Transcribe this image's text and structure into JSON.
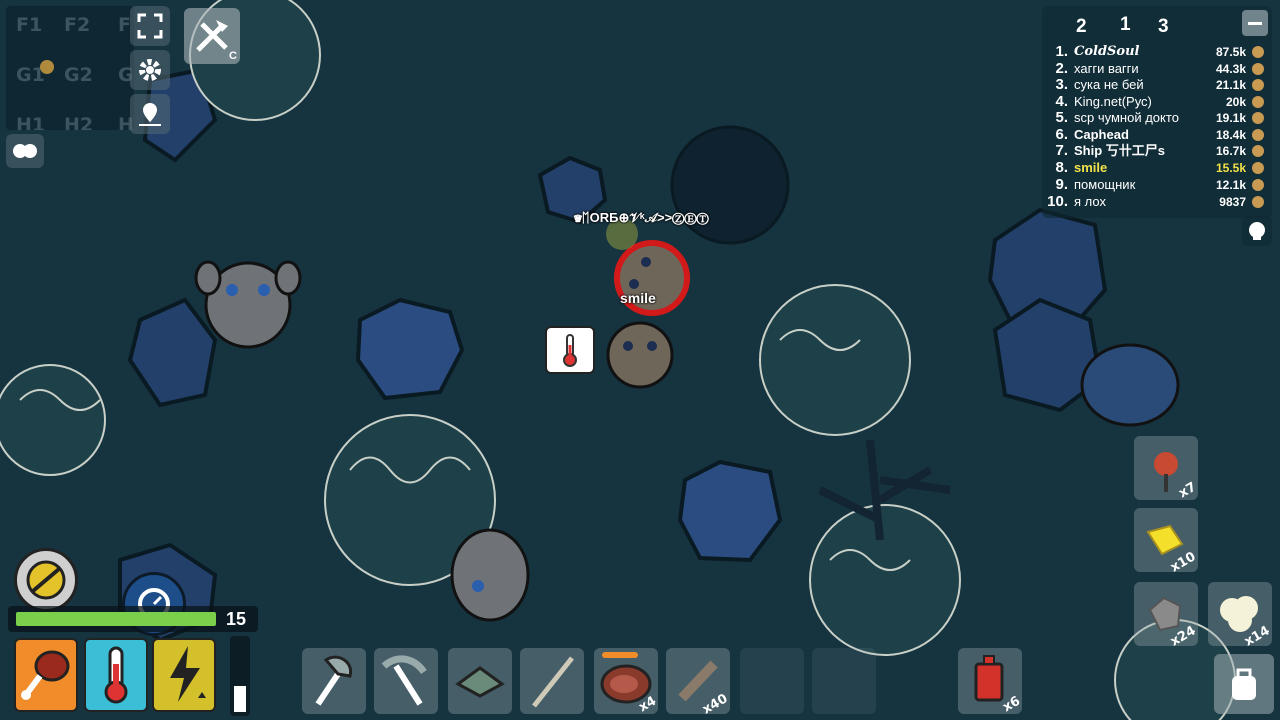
{
  "minimap": {
    "cells": [
      {
        "label": "F1"
      },
      {
        "label": "F2"
      },
      {
        "label": "F"
      },
      {
        "label": "G1"
      },
      {
        "label": "G2"
      },
      {
        "label": "G"
      },
      {
        "label": "H1"
      },
      {
        "label": "H2"
      },
      {
        "label": "H"
      }
    ]
  },
  "craft_hotkey": "C",
  "leaderboard": {
    "tabs": [
      "2",
      "1",
      "3"
    ],
    "rows": [
      {
        "rank": "1.",
        "name": "ColdSoul",
        "score": "87.5k",
        "highlight": false
      },
      {
        "rank": "2.",
        "name": "хагги вагги",
        "score": "44.3k",
        "highlight": false
      },
      {
        "rank": "3.",
        "name": "сука не бей",
        "score": "21.1k",
        "highlight": false
      },
      {
        "rank": "4.",
        "name": "King.net(Рус)",
        "score": "20k",
        "highlight": false
      },
      {
        "rank": "5.",
        "name": "scp чумной доктo",
        "score": "19.1k",
        "highlight": false
      },
      {
        "rank": "6.",
        "name": "Caphead",
        "score": "18.4k",
        "highlight": false
      },
      {
        "rank": "7.",
        "name": "Ship 丂卄工尸s",
        "score": "16.7k",
        "highlight": false
      },
      {
        "rank": "8.",
        "name": "smile",
        "score": "15.5k",
        "highlight": true
      },
      {
        "rank": "9.",
        "name": "помощник",
        "score": "12.1k",
        "highlight": false
      },
      {
        "rank": "10.",
        "name": "я лох",
        "score": "9837",
        "highlight": false
      }
    ]
  },
  "players": {
    "self_name": "smile",
    "other_name": "♛ᛖORƂ⊕𝒱ᵏ𝒜>>ⓏⒺⓉ"
  },
  "status": {
    "level": "15",
    "xp_fraction": 0.98
  },
  "hotbar": [
    {
      "item": "stone-axe",
      "count": ""
    },
    {
      "item": "stone-pickaxe",
      "count": ""
    },
    {
      "item": "stone-shovel",
      "count": ""
    },
    {
      "item": "wooden-spear",
      "count": ""
    },
    {
      "item": "raw-meat",
      "count": "x4"
    },
    {
      "item": "wood",
      "count": "x40"
    },
    {
      "item": "empty",
      "count": ""
    },
    {
      "item": "empty",
      "count": ""
    },
    {
      "item": "gasoline-can",
      "count": "x6"
    }
  ],
  "inventory_side": [
    {
      "item": "flower",
      "count": "x7"
    },
    {
      "item": "gold",
      "count": "x10"
    },
    {
      "item": "stone",
      "count": "x24"
    },
    {
      "item": "cotton",
      "count": "x14"
    }
  ],
  "colors": {
    "food": "#f08c2a",
    "cold": "#3bbfd6",
    "energy": "#d3c02a",
    "xp": "#7ad04a",
    "highlight": "#f2e24a"
  }
}
